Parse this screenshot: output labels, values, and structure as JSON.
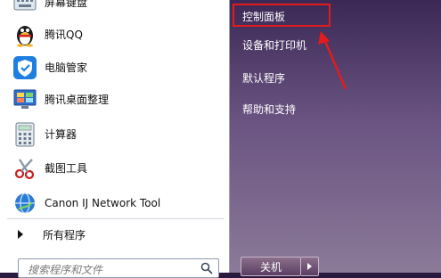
{
  "left_menu": {
    "items": [
      {
        "label": "屏幕键盘",
        "icon": "keyboard-icon"
      },
      {
        "label": "腾讯QQ",
        "icon": "qq-penguin-icon"
      },
      {
        "label": "电脑管家",
        "icon": "shield-check-icon"
      },
      {
        "label": "腾讯桌面整理",
        "icon": "desktop-monitor-icon"
      },
      {
        "label": "计算器",
        "icon": "calculator-icon"
      },
      {
        "label": "截图工具",
        "icon": "scissors-icon"
      },
      {
        "label": "Canon IJ Network Tool",
        "icon": "network-globe-icon"
      }
    ],
    "all_programs": "所有程序",
    "search_placeholder": "搜索程序和文件"
  },
  "right_menu": {
    "items": [
      {
        "label": "控制面板"
      },
      {
        "label": "设备和打印机"
      },
      {
        "label": "默认程序"
      },
      {
        "label": "帮助和支持"
      }
    ],
    "shutdown": "关机"
  },
  "annotation": {
    "highlight_color": "#e31b1b"
  }
}
